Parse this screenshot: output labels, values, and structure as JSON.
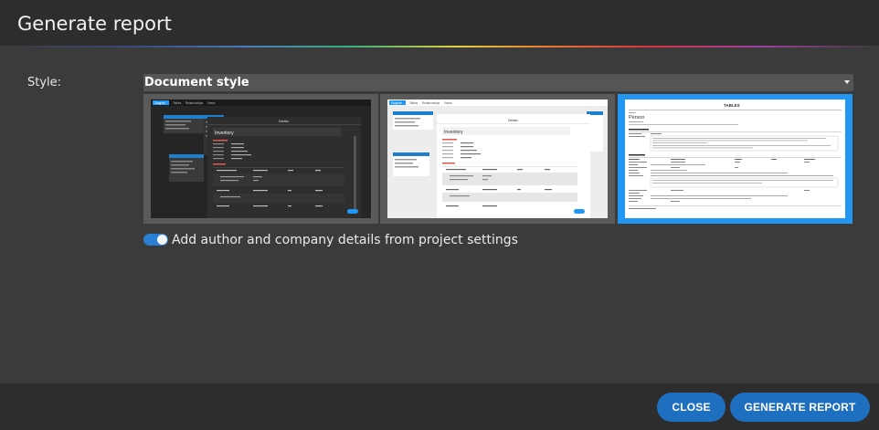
{
  "dialog": {
    "title": "Generate report"
  },
  "style": {
    "label": "Style:",
    "selected": "Document style"
  },
  "thumbnails": [
    {
      "id": "dark",
      "tabs": [
        "Diagram",
        "Tables",
        "Relationships",
        "Views"
      ],
      "panel_title": "Details",
      "panel_name": "Inventory"
    },
    {
      "id": "light",
      "tabs": [
        "Diagram",
        "Tables",
        "Relationships",
        "Views"
      ],
      "panel_title": "Details",
      "panel_name": "Inventory"
    },
    {
      "id": "document",
      "section": "TABLES",
      "table_name": "Person"
    }
  ],
  "option": {
    "label": "Add author and company details from project settings",
    "enabled": true
  },
  "buttons": {
    "close": "CLOSE",
    "generate": "GENERATE REPORT"
  },
  "colors": {
    "accent": "#2196f3",
    "button": "#1e6fc0",
    "dialog_bg": "#3b3b3b",
    "bar_bg": "#2d2d2d"
  }
}
